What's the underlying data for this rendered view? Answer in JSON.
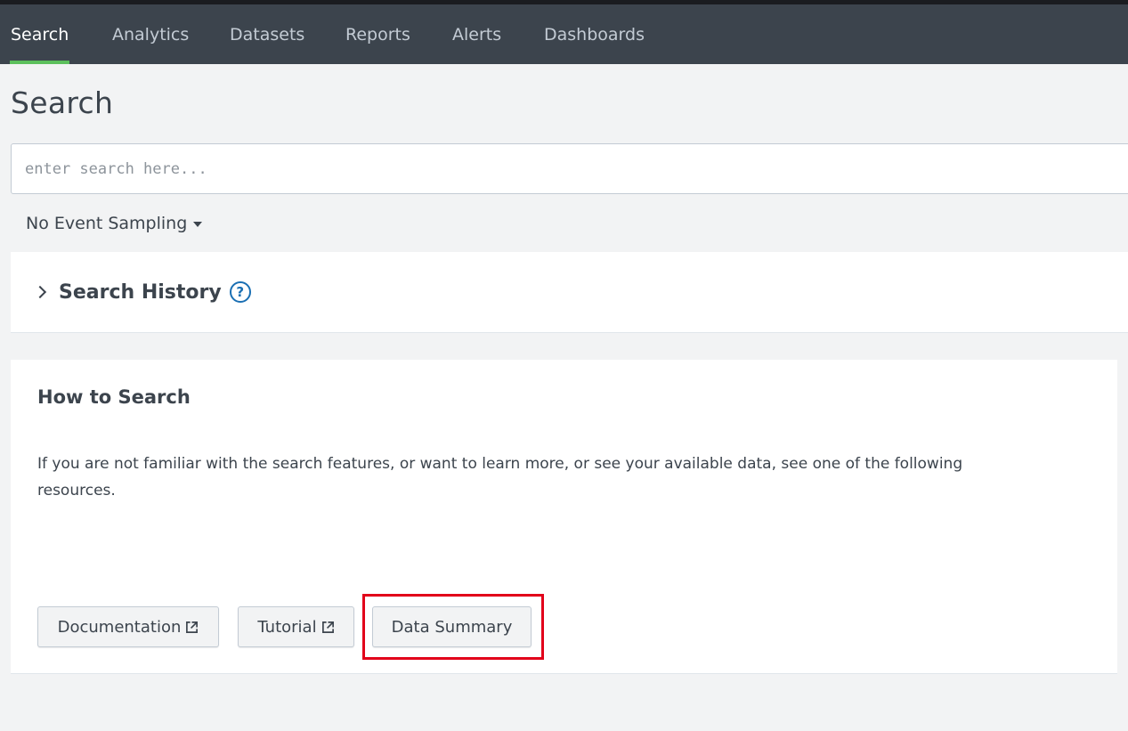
{
  "nav": {
    "tabs": [
      {
        "label": "Search",
        "active": true
      },
      {
        "label": "Analytics"
      },
      {
        "label": "Datasets"
      },
      {
        "label": "Reports"
      },
      {
        "label": "Alerts"
      },
      {
        "label": "Dashboards"
      }
    ],
    "active_underline_color": "#5cc05c"
  },
  "page": {
    "title": "Search"
  },
  "search": {
    "placeholder": "enter search here...",
    "value": ""
  },
  "sampling": {
    "label": "No Event Sampling",
    "icon": "caret-down-icon"
  },
  "history": {
    "title": "Search History",
    "help_icon_glyph": "?",
    "icons": [
      "chevron-right-icon",
      "help-icon"
    ]
  },
  "how_to_search": {
    "title": "How to Search",
    "description": "If you are not familiar with the search features, or want to learn more, or see your available data, see one of the following resources.",
    "buttons": [
      {
        "label": "Documentation",
        "icon": "external-link-icon"
      },
      {
        "label": "Tutorial",
        "icon": "external-link-icon"
      },
      {
        "label": "Data Summary",
        "highlighted": true
      }
    ],
    "highlight_color": "#e2001a"
  }
}
